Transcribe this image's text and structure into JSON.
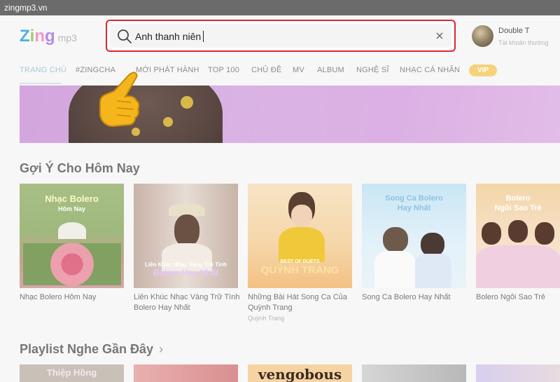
{
  "browser": {
    "url": "zingmp3.vn"
  },
  "header": {
    "logo_text": "Zing",
    "logo_suffix": "mp3",
    "search_value": "Anh thanh niên",
    "user_name": "Double T",
    "user_subtitle": "Tài khoản thường"
  },
  "nav": {
    "items": [
      "TRANG CHỦ",
      "#ZINGCHA",
      "MỚI PHÁT HÀNH",
      "TOP 100",
      "CHỦ ĐỀ",
      "MV",
      "ALBUM",
      "NGHỆ SĨ",
      "NHẠC CÁ NHÂN"
    ],
    "vip": "VIP"
  },
  "section1": {
    "title": "Gợi Ý Cho Hôm Nay",
    "cards": [
      {
        "title": "Nhạc Bolero Hôm Nay",
        "subtitle": "",
        "art_title": "Nhạc Bolero",
        "art_sub": "Hôm Nay"
      },
      {
        "title": "Liên Khúc Nhạc Vàng Trữ Tình Bolero Hay Nhất",
        "subtitle": "",
        "art_title": "Liên Khúc Nhạc Vàng Trữ Tình",
        "art_sub": "Bolero Hay Nhất"
      },
      {
        "title": "Những Bài Hát Song Ca Của Quỳnh Trang",
        "subtitle": "Quỳnh Trang",
        "art_title": "BEST OF DUETS",
        "art_sub": "QUỲNH TRANG"
      },
      {
        "title": "Song Ca Bolero Hay Nhất",
        "subtitle": "",
        "art_title": "Song Ca Bolero",
        "art_sub": "Hay Nhất"
      },
      {
        "title": "Bolero Ngôi Sao Trẻ",
        "subtitle": "",
        "art_title": "Bolero",
        "art_sub": "Ngôi Sao Trẻ"
      }
    ]
  },
  "section2": {
    "title": "Playlist Nghe Gần Đây",
    "chevron": "›",
    "cards": [
      {
        "art_title": "Thiệp Hồng"
      },
      {
        "art_title": ""
      },
      {
        "art_title": "vengobous"
      },
      {
        "art_title": ""
      },
      {
        "art_title": ""
      }
    ]
  },
  "colors": {
    "accent_red": "#e0262e",
    "active_nav": "#a7c9d9",
    "vip": "#f4d37a"
  }
}
